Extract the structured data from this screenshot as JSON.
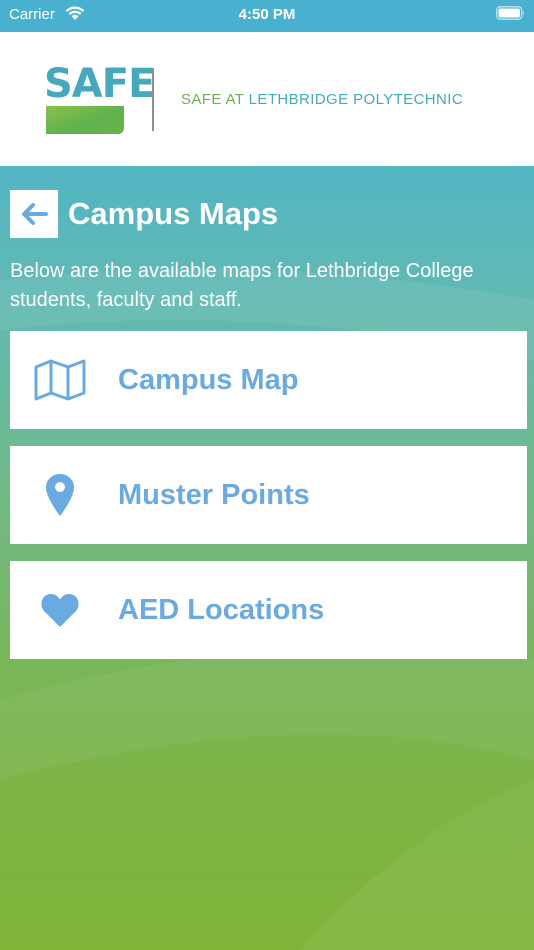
{
  "status_bar": {
    "carrier": "Carrier",
    "time": "4:50 PM"
  },
  "header": {
    "logo_text": "SAFE",
    "tagline_prefix": "SAFE AT ",
    "tagline_suffix": "LETHBRIDGE POLYTECHNIC"
  },
  "page": {
    "title": "Campus Maps",
    "intro": "Below are the available maps for Lethbridge College students, faculty and staff."
  },
  "menu": [
    {
      "label": "Campus Map",
      "icon": "map-icon"
    },
    {
      "label": "Muster Points",
      "icon": "map-pin-icon"
    },
    {
      "label": "AED Locations",
      "icon": "heart-icon"
    }
  ],
  "colors": {
    "accent_blue": "#6aaae0",
    "teal": "#45a8bb",
    "green": "#7db443",
    "white": "#ffffff"
  }
}
